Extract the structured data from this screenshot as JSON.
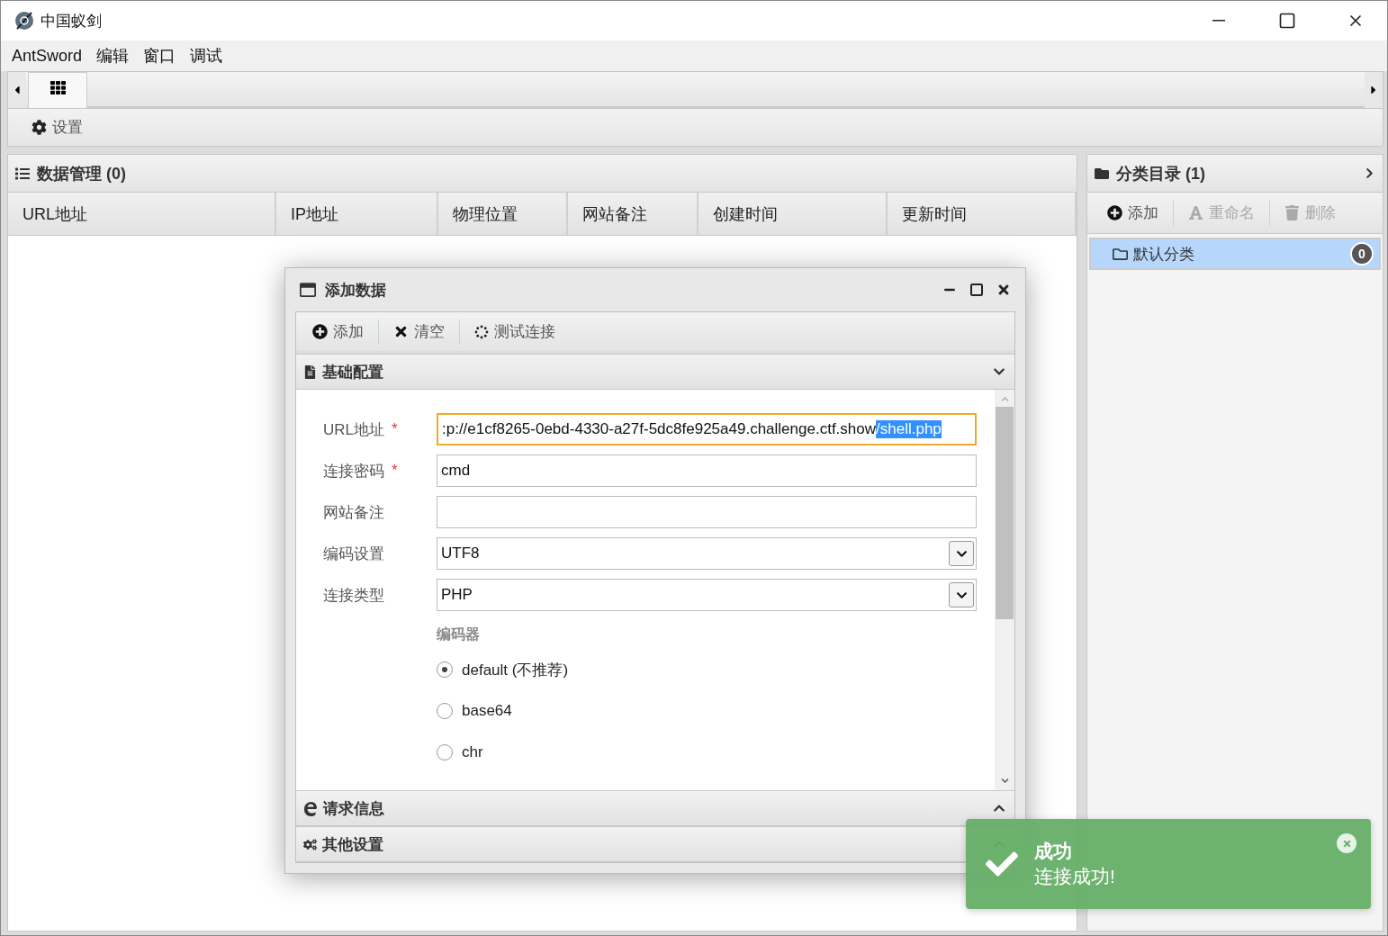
{
  "window": {
    "title": "中国蚁剑"
  },
  "menu": [
    "AntSword",
    "编辑",
    "窗口",
    "调试"
  ],
  "tabs": [
    {
      "selected": true
    }
  ],
  "toolbar": {
    "settings": "设置"
  },
  "data_panel": {
    "title": "数据管理 (0)",
    "columns": [
      "URL地址",
      "IP地址",
      "物理位置",
      "网站备注",
      "创建时间",
      "更新时间"
    ]
  },
  "category_panel": {
    "title": "分类目录 (1)",
    "actions": [
      {
        "label": "添加",
        "disabled": false
      },
      {
        "label": "重命名",
        "disabled": true
      },
      {
        "label": "删除",
        "disabled": true
      }
    ],
    "items": [
      {
        "label": "默认分类",
        "count": "0",
        "selected": true
      }
    ]
  },
  "dialog": {
    "title": "添加数据",
    "actions": [
      "添加",
      "清空",
      "测试连接"
    ],
    "sections": [
      {
        "title": "基础配置",
        "expanded": true
      },
      {
        "title": "请求信息",
        "expanded": false
      },
      {
        "title": "其他设置",
        "expanded": false
      }
    ],
    "fields": [
      {
        "kind": "text",
        "label": "URL地址",
        "required_mark": "*",
        "focused": true,
        "value": ":p://e1cf8265-0ebd-4330-a27f-5dc8fe925a49.challenge.ctf.show",
        "selected_value": "/shell.php"
      },
      {
        "kind": "text",
        "label": "连接密码",
        "required_mark": "*",
        "focused": false,
        "value": "cmd"
      },
      {
        "kind": "text",
        "label": "网站备注",
        "focused": false
      },
      {
        "kind": "select",
        "label": "编码设置",
        "value": "UTF8"
      },
      {
        "kind": "select",
        "label": "连接类型",
        "value": "PHP"
      }
    ],
    "encoder": {
      "title": "编码器",
      "options": [
        {
          "label": "default (不推荐)",
          "selected": true
        },
        {
          "label": "base64",
          "selected": false
        },
        {
          "label": "chr",
          "selected": false
        }
      ]
    }
  },
  "toast": {
    "title": "成功",
    "message": "连接成功!"
  }
}
